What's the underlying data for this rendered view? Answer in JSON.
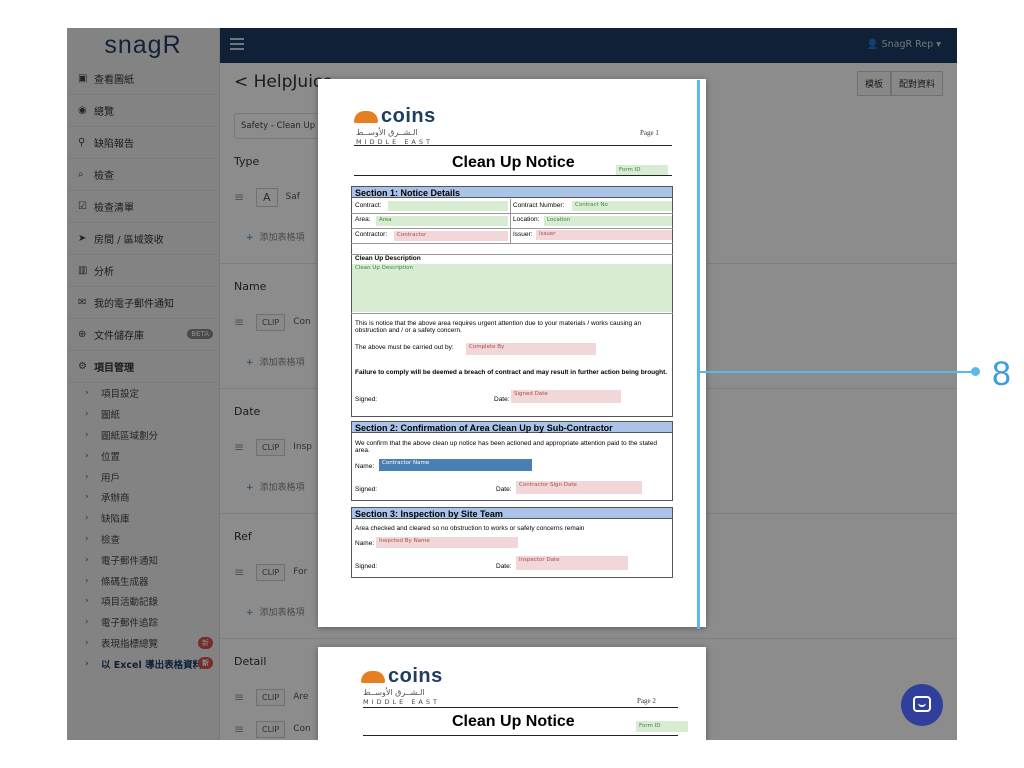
{
  "app": {
    "logo": "snagR"
  },
  "topbar": {
    "user": "SnagR Rep ▾"
  },
  "sidebar": {
    "items": [
      {
        "icon": "▣",
        "label": "查看圖紙"
      },
      {
        "icon": "◉",
        "label": "總覽"
      },
      {
        "icon": "⚲",
        "label": "缺陷報告"
      },
      {
        "icon": "⌕",
        "label": "檢查"
      },
      {
        "icon": "☑",
        "label": "檢查清單"
      },
      {
        "icon": "➤",
        "label": "房間 / 區域簽收"
      },
      {
        "icon": "▥",
        "label": "分析"
      },
      {
        "icon": "✉",
        "label": "我的電子郵件通知"
      },
      {
        "icon": "⊕",
        "label": "文件儲存庫",
        "badge": "BETA"
      },
      {
        "icon": "⚙",
        "label": "項目管理"
      }
    ],
    "sub_items": [
      {
        "label": "項目設定"
      },
      {
        "label": "圖紙"
      },
      {
        "label": "圖紙區域劃分"
      },
      {
        "label": "位置"
      },
      {
        "label": "用戶"
      },
      {
        "label": "承辦商"
      },
      {
        "label": "缺陷庫"
      },
      {
        "label": "檢查"
      },
      {
        "label": "電子郵件通知"
      },
      {
        "label": "條碼生成器"
      },
      {
        "label": "項目活動記錄"
      },
      {
        "label": "電子郵件追踪"
      },
      {
        "label": "表現指標總覽",
        "badge": "新"
      },
      {
        "label": "以 Excel 導出表格資料",
        "badge": "新"
      }
    ]
  },
  "main": {
    "breadcrumb": "< HelpJuice",
    "buttons": [
      "模板",
      "配對資料"
    ],
    "select_value": "Safety - Clean Up N",
    "sections": [
      {
        "title": "Type",
        "field_tag": "A",
        "field_value": "Saf"
      },
      {
        "title": "Name",
        "field_tag": "CLIP",
        "field_value": "Con"
      },
      {
        "title": "Date",
        "field_tag": "CLIP",
        "field_value": "Insp"
      },
      {
        "title": "Ref",
        "field_tag": "CLIP",
        "field_value": "For"
      },
      {
        "title": "Detail",
        "field_tag": "CLIP",
        "field_value": "Are"
      }
    ],
    "extra_row": "Con",
    "add_label": "添加表格項"
  },
  "document": {
    "logo": "coins",
    "arabic": "الـشــرق الأوســط",
    "middle_east": "MIDDLE EAST",
    "page1": "Page 1",
    "page2": "Page 2",
    "title": "Clean Up Notice",
    "form_id": "Form ID",
    "section1": "Section 1: Notice Details",
    "contract": "Contract:",
    "contract_number": "Contract Number:",
    "contract_no_field": "Contract No",
    "area": "Area:",
    "area_field": "Area",
    "location": "Location:",
    "location_field": "Location",
    "contractor": "Contractor:",
    "contractor_field": "Contractor",
    "issuer": "Issuer:",
    "issuer_field": "Issuer",
    "desc_head": "Clean Up Description",
    "desc_field": "Clean Up Description",
    "notice_text": "This is notice that the above area requires urgent attention due to your materials / works causing an obstruction and / or a safety concern.",
    "carried_out": "The above must be carried out by:",
    "complete_by": "Complete By",
    "failure": "Failure to comply will be deemed a breach of contract and may result in further action being brought.",
    "signed": "Signed:",
    "date": "Date:",
    "signed_date": "Signed Date",
    "section2": "Section 2: Confirmation of Area Clean Up by Sub-Contractor",
    "confirm_text": "We confirm that the above clean up notice has been actioned and appropriate attention paid to the stated area.",
    "name": "Name:",
    "contractor_name": "Contractor Name",
    "contractor_sign_date": "Contractor Sign Date",
    "section3": "Section 3: Inspection by Site Team",
    "checked_text": "Area checked and cleared so no obstruction to works or safety concerns remain",
    "inspected_by": "Inepcted By Name",
    "inspector_date": "Inspector Date"
  },
  "annotation": {
    "number": "8"
  }
}
